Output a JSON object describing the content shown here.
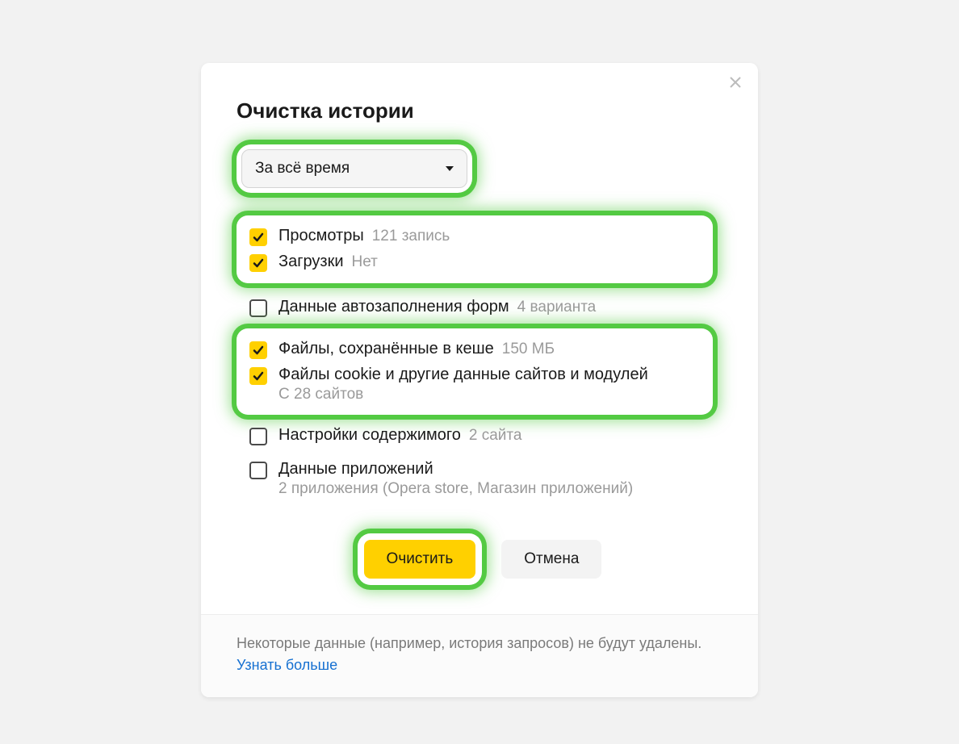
{
  "dialog": {
    "title": "Очистка истории",
    "time_range": "За всё время",
    "options": {
      "views": {
        "label": "Просмотры",
        "hint": "121 запись",
        "checked": true
      },
      "downloads": {
        "label": "Загрузки",
        "hint": "Нет",
        "checked": true
      },
      "autofill": {
        "label": "Данные автозаполнения форм",
        "hint": "4 варианта",
        "checked": false
      },
      "cache": {
        "label": "Файлы, сохранённые в кеше",
        "hint": "150 МБ",
        "checked": true
      },
      "cookies": {
        "label": "Файлы cookie и другие данные сайтов и модулей",
        "sub": "С 28 сайтов",
        "checked": true
      },
      "content_settings": {
        "label": "Настройки содержимого",
        "hint": "2 сайта",
        "checked": false
      },
      "app_data": {
        "label": "Данные приложений",
        "sub": "2 приложения (Opera store, Магазин приложений)",
        "checked": false
      }
    },
    "buttons": {
      "clear": "Очистить",
      "cancel": "Отмена"
    },
    "footer": {
      "text": "Некоторые данные (например, история запросов) не будут удалены.",
      "link": "Узнать больше"
    }
  }
}
